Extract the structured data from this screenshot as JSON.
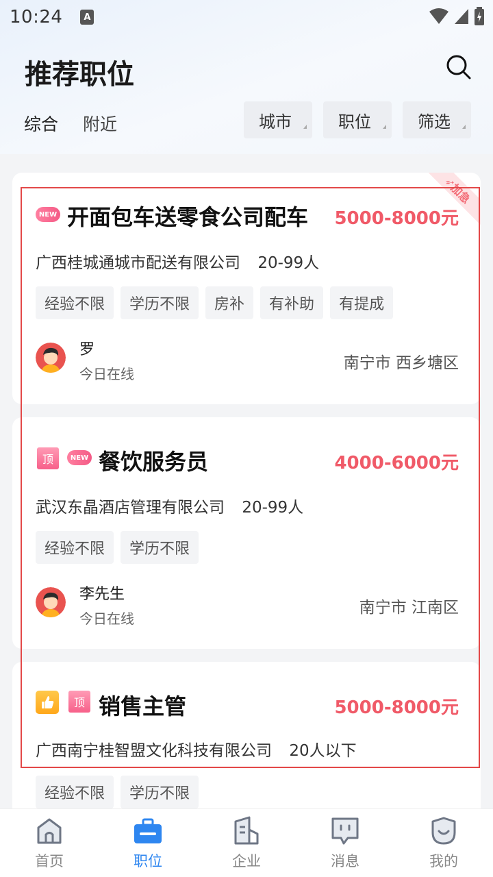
{
  "status_bar": {
    "time": "10:24",
    "notification_icon": "A"
  },
  "header": {
    "title": "推荐职位",
    "search_icon": "search-icon"
  },
  "tabs": [
    {
      "label": "综合",
      "active": true
    },
    {
      "label": "附近",
      "active": false
    }
  ],
  "filters": [
    {
      "label": "城市"
    },
    {
      "label": "职位"
    },
    {
      "label": "筛选"
    }
  ],
  "jobs": [
    {
      "badges": [
        "NEW"
      ],
      "title": "开面包车送零食公司配车",
      "salary": "5000-8000元",
      "company": "广西桂城通城市配送有限公司",
      "size": "20-99人",
      "tags": [
        "经验不限",
        "学历不限",
        "房补",
        "有补助",
        "有提成"
      ],
      "recruiter": "罗",
      "online": "今日在线",
      "location": "南宁市 西乡塘区",
      "ribbon": "加急"
    },
    {
      "badges": [
        "顶",
        "NEW"
      ],
      "title": "餐饮服务员",
      "salary": "4000-6000元",
      "company": "武汉东晶酒店管理有限公司",
      "size": "20-99人",
      "tags": [
        "经验不限",
        "学历不限"
      ],
      "recruiter": "李先生",
      "online": "今日在线",
      "location": "南宁市 江南区"
    },
    {
      "badges": [
        "顶"
      ],
      "title": "销售主管",
      "salary": "5000-8000元",
      "company": "广西南宁桂智盟文化科技有限公司",
      "size": "20人以下",
      "tags": [
        "经验不限",
        "学历不限"
      ]
    }
  ],
  "bottom_nav": [
    {
      "label": "首页",
      "icon": "home-icon",
      "active": false
    },
    {
      "label": "职位",
      "icon": "briefcase-icon",
      "active": true
    },
    {
      "label": "企业",
      "icon": "building-icon",
      "active": false
    },
    {
      "label": "消息",
      "icon": "message-icon",
      "active": false
    },
    {
      "label": "我的",
      "icon": "profile-icon",
      "active": false
    }
  ],
  "colors": {
    "accent": "#2e86f0",
    "salary": "#f05a68",
    "badge_pink": "#f45a86",
    "highlight_border": "#e34848"
  }
}
